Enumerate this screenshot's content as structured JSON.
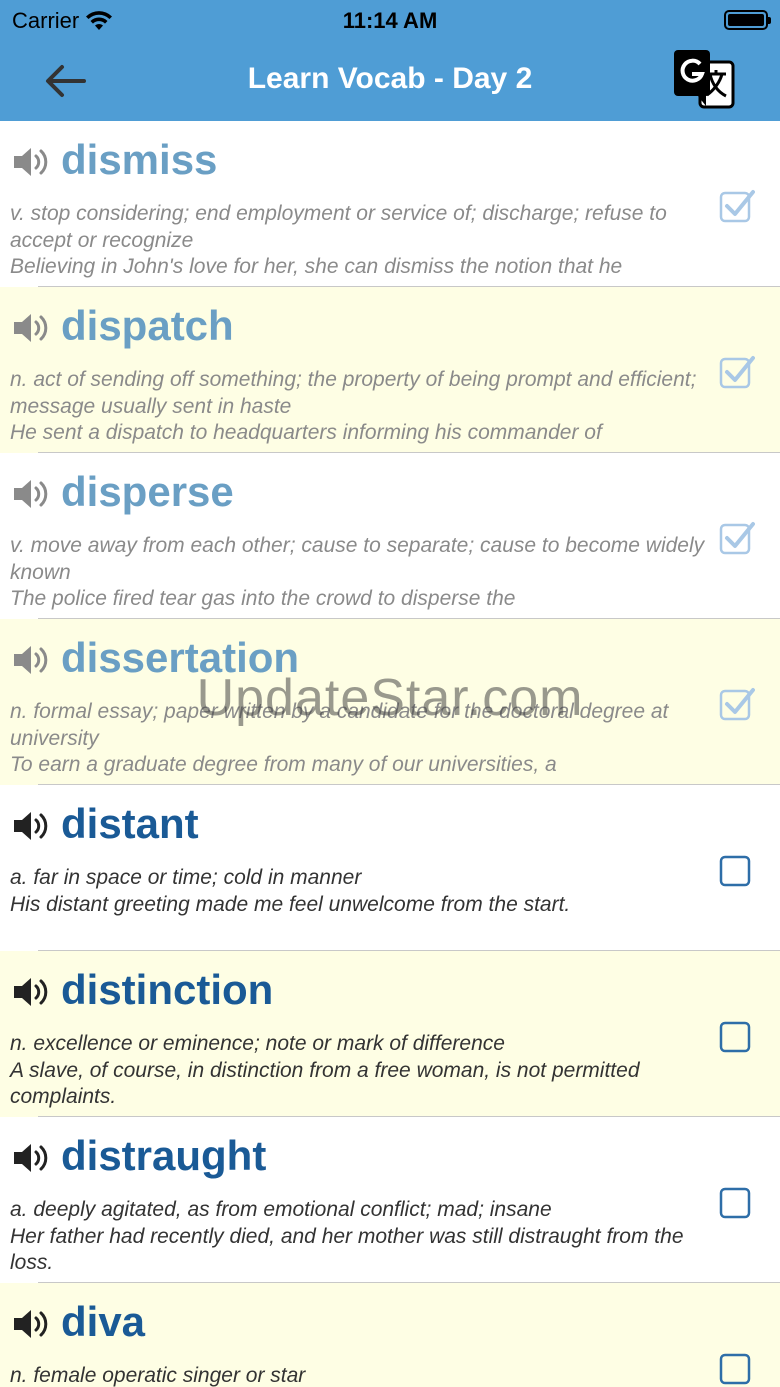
{
  "status_bar": {
    "carrier": "Carrier",
    "time": "11:14 AM"
  },
  "nav": {
    "title": "Learn Vocab - Day 2",
    "back_icon": "arrow-left-icon",
    "translate_icon": "google-translate-icon"
  },
  "colors": {
    "nav_background": "#4f9dd5",
    "alt_row_background": "#fefee4",
    "learned_word": "#6a9fc4",
    "new_word": "#1a5a96"
  },
  "words": [
    {
      "word": "dismiss",
      "definition": "v. stop considering; end employment or service of; discharge; refuse to accept or recognize",
      "example": "Believing in John's love for her, she can dismiss the notion that he",
      "checked": true
    },
    {
      "word": "dispatch",
      "definition": "n. act of sending off something; the property of being prompt and efficient; message usually sent in haste",
      "example": "He sent a dispatch to headquarters informing his commander of",
      "checked": true
    },
    {
      "word": "disperse",
      "definition": "v. move away from each other; cause to separate; cause to become widely known",
      "example": "The police fired tear gas into the crowd to disperse the",
      "checked": true
    },
    {
      "word": "dissertation",
      "definition": "n. formal essay;  paper written by a candidate for the doctoral degree at university",
      "example": "To earn a graduate degree from many of our universities, a",
      "checked": true
    },
    {
      "word": "distant",
      "definition": "a. far in space or time; cold in manner",
      "example": "His distant greeting made me feel unwelcome from the start.",
      "checked": false
    },
    {
      "word": "distinction",
      "definition": "n. excellence or eminence; note or mark of difference",
      "example": "A slave, of course, in distinction from a free woman, is not permitted complaints.",
      "checked": false
    },
    {
      "word": "distraught",
      "definition": "a. deeply agitated, as from emotional conflict; mad; insane",
      "example": "Her father had recently died, and her mother was still distraught from the loss.",
      "checked": false
    },
    {
      "word": "diva",
      "definition": "n. female operatic singer or star",
      "example": "",
      "checked": false
    }
  ],
  "watermark": "UpdateStar.com"
}
